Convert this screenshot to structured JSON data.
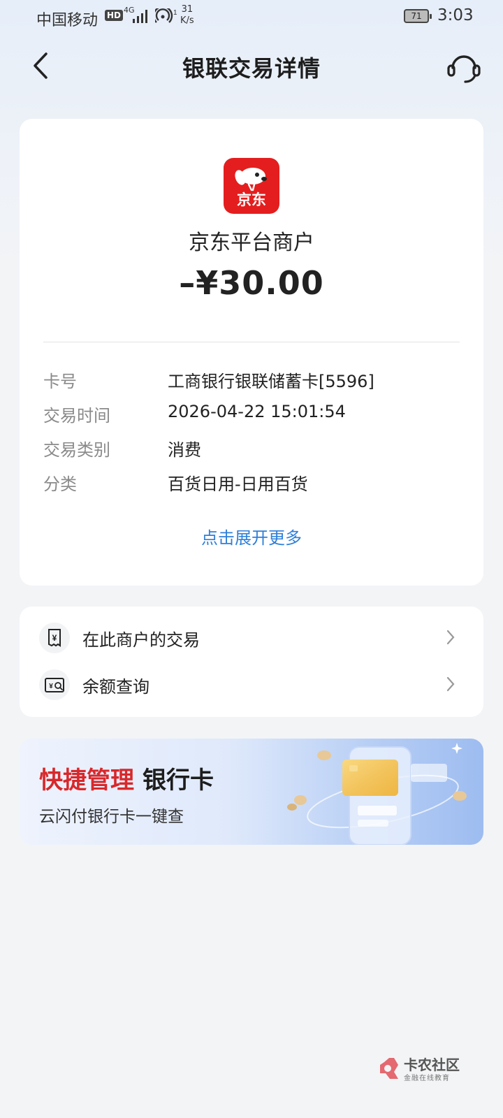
{
  "status_bar": {
    "carrier": "中国移动",
    "hd": "HD",
    "network": "4G",
    "wifi_sub": "1",
    "speed_value": "31",
    "speed_unit": "K/s",
    "battery": "71",
    "time": "3:03"
  },
  "header": {
    "title": "银联交易详情"
  },
  "merchant": {
    "logo_text": "京东",
    "name": "京东平台商户",
    "amount": "–¥30.00"
  },
  "details": [
    {
      "label": "卡号",
      "value": "工商银行银联储蓄卡[5596]"
    },
    {
      "label": "交易时间",
      "value": "2026-04-22 15:01:54"
    },
    {
      "label": "交易类别",
      "value": "消费"
    },
    {
      "label": "分类",
      "value": "百货日用-日用百货"
    }
  ],
  "expand_link": "点击展开更多",
  "actions": [
    {
      "label": "在此商户的交易",
      "icon": "receipt-icon"
    },
    {
      "label": "余额查询",
      "icon": "balance-search-icon"
    }
  ],
  "banner": {
    "title_red": "快捷管理",
    "title_dark": "银行卡",
    "subtitle": "云闪付银行卡一键查"
  },
  "watermark": {
    "name": "卡农社区",
    "tagline": "金融在线教育"
  },
  "colors": {
    "accent_blue": "#2f7fd8",
    "brand_red": "#e41e1e",
    "banner_red": "#d8282b"
  }
}
